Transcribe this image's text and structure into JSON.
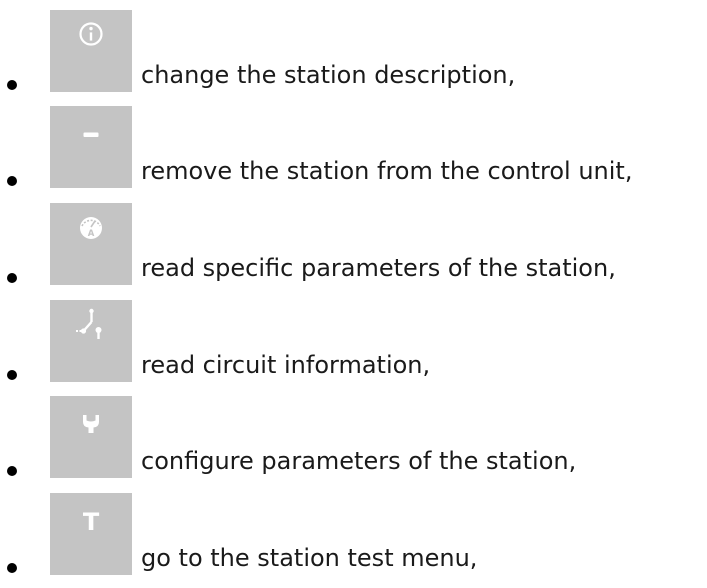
{
  "items": [
    {
      "icon": "info-icon",
      "label": "change the station description,"
    },
    {
      "icon": "minus-icon",
      "label": "remove the station from the control unit,"
    },
    {
      "icon": "gauge-icon",
      "label": "read specific parameters of the station,"
    },
    {
      "icon": "circuit-icon",
      "label": "read circuit information,"
    },
    {
      "icon": "wrench-icon",
      "label": "configure parameters of the station,"
    },
    {
      "icon": "test-icon",
      "label": "go to the station test menu,"
    }
  ],
  "icon_glyphs": {
    "test_letter": "T",
    "gauge_letter": "A"
  },
  "colors": {
    "icon_background": "#c4c4c4",
    "icon_foreground": "#ffffff",
    "text": "#1a1a1a"
  }
}
